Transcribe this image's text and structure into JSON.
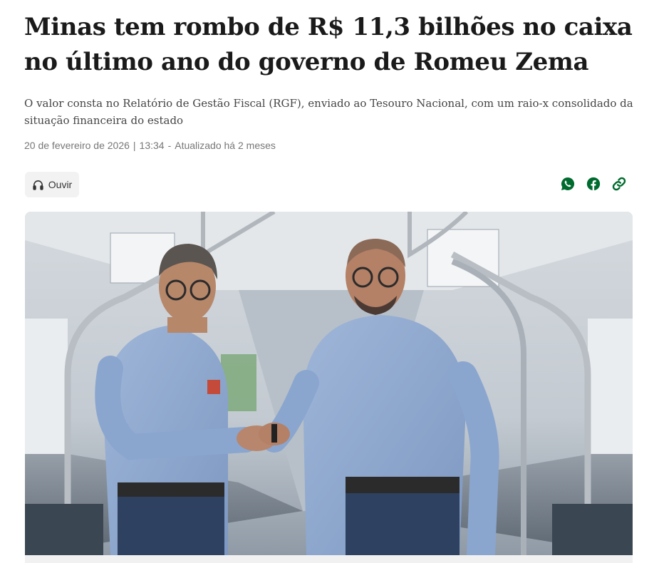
{
  "article": {
    "headline": "Minas tem rombo de R$ 11,3 bilhões no caixa no último ano do governo de Romeu Zema",
    "subtitle": "O valor consta no Relatório de Gestão Fiscal (RGF), enviado ao Tesouro Nacional, com um raio-x consolidado da situação financeira do estado",
    "date": "20 de fevereiro de 2026",
    "separator": "|",
    "time": "13:34",
    "dash": "-",
    "updated": "Atualizado há 2 meses"
  },
  "listen": {
    "label": "Ouvir",
    "icon": "headphones-icon"
  },
  "share": {
    "accent": "#006b2e",
    "icons": [
      "whatsapp-icon",
      "facebook-icon",
      "link-icon"
    ]
  },
  "image": {
    "subject": "photo",
    "palette": [
      "#cfd6dc",
      "#8aa6cf",
      "#2a3a5c"
    ]
  }
}
